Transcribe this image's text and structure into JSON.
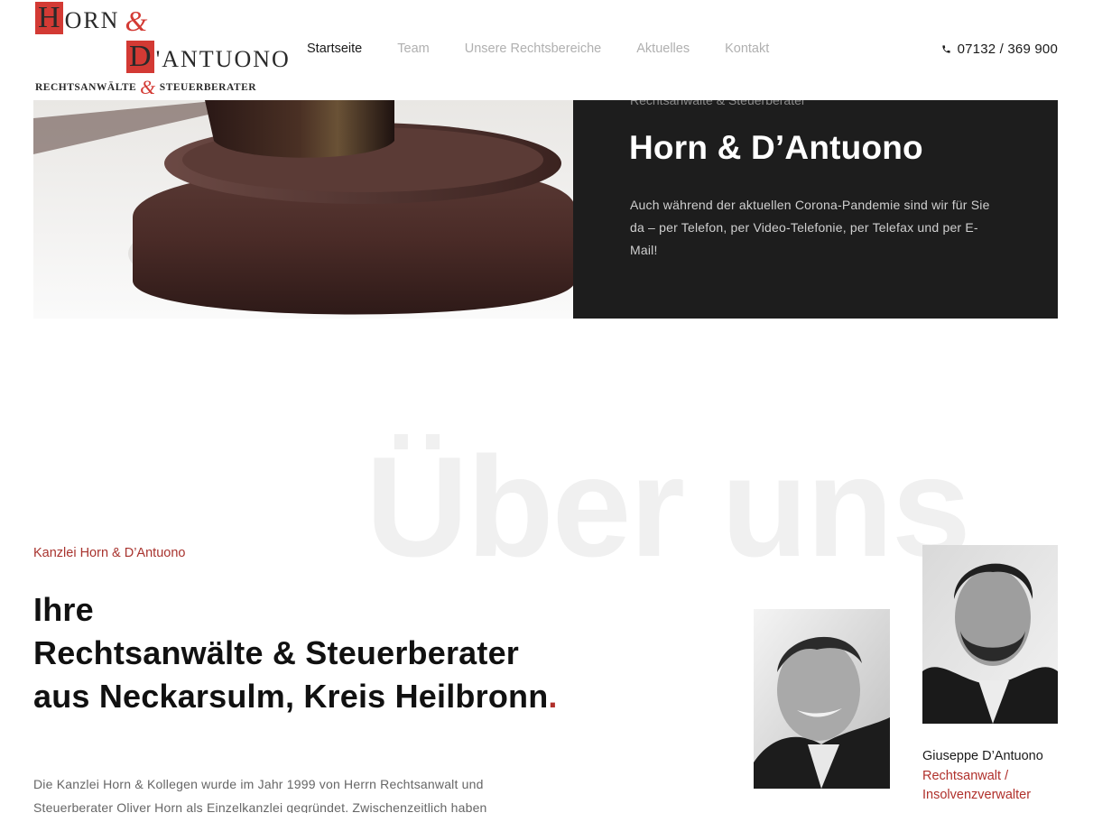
{
  "header": {
    "logo": {
      "line1_cap": "H",
      "line1_rest": "ORN",
      "line1_amp": "&",
      "line2_cap": "D",
      "line2_rest": "'ANTUONO",
      "line3_left": "RECHTSANWÄLTE",
      "line3_amp": "&",
      "line3_right": "STEUERBERATER",
      "accent_color": "#d33a34"
    },
    "nav": [
      {
        "label": "Startseite",
        "active": true
      },
      {
        "label": "Team",
        "active": false
      },
      {
        "label": "Unsere Rechtsbereiche",
        "active": false
      },
      {
        "label": "Aktuelles",
        "active": false
      },
      {
        "label": "Kontakt",
        "active": false
      }
    ],
    "phone": {
      "icon": "phone-icon",
      "number": "07132 / 369 900"
    }
  },
  "hero": {
    "eyebrow": "Rechtsanwälte & Steuerberater",
    "title": "Horn & D’Antuono",
    "text": "Auch während der aktuellen Corona-Pandemie sind wir für Sie da – per Telefon, per Video-Telefonie, per Telefax und per E-Mail!",
    "image": "judge-gavel-image"
  },
  "about": {
    "watermark": "Über uns",
    "kicker": "Kanzlei Horn & D’Antuono",
    "title_lines": [
      "Ihre",
      "Rechtsanwälte & Steuerberater",
      "aus Neckarsulm, Kreis Heilbronn"
    ],
    "title_dot": ".",
    "text": "Die Kanzlei Horn & Kollegen wurde im Jahr 1999 von Herrn Rechtsanwalt und Steuerberater Oliver Horn als Einzelkanzlei gegründet. Zwischenzeitlich haben",
    "members": [
      {
        "image": "portrait-oliver-horn"
      },
      {
        "image": "portrait-giuseppe-dantuono",
        "name": "Giuseppe D’Antuono",
        "role": "Rechtsanwalt / Insolvenzverwalter"
      }
    ]
  },
  "colors": {
    "accent": "#b0302b",
    "dark_panel": "#1d1d1d",
    "nav_inactive": "#b0b0b0"
  }
}
